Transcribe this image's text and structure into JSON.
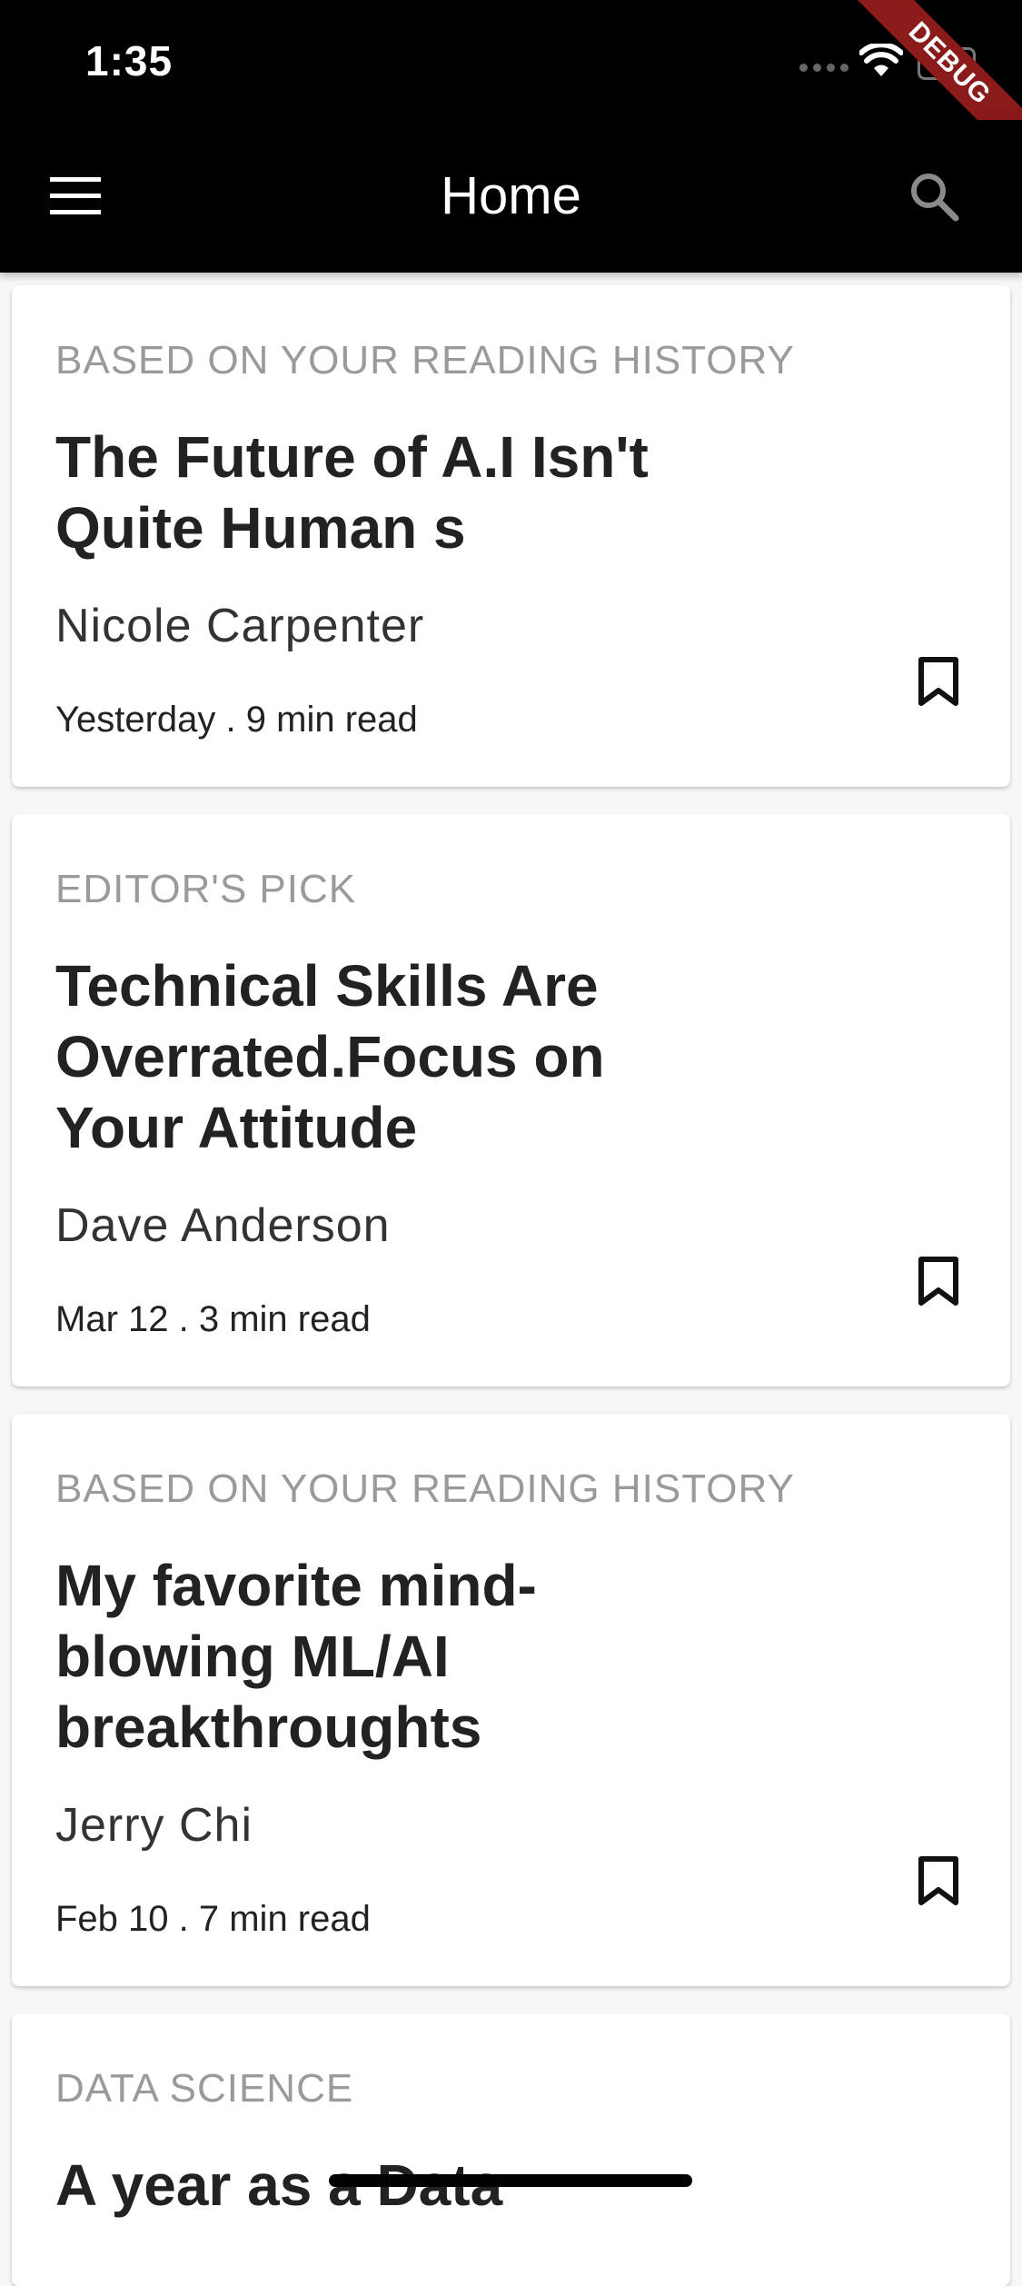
{
  "status_bar": {
    "time": "1:35",
    "debug_label": "DEBUG"
  },
  "app_bar": {
    "title": "Home",
    "menu_icon": "menu-icon",
    "search_icon": "search-icon"
  },
  "articles": [
    {
      "category": "BASED ON YOUR READING HISTORY",
      "title": "The Future of A.I Isn't Quite Human s",
      "author": "Nicole Carpenter",
      "meta": "Yesterday . 9 min read"
    },
    {
      "category": "EDITOR'S PICK",
      "title": "Technical Skills Are Overrated.Focus on Your Attitude",
      "author": "Dave Anderson",
      "meta": "Mar 12 . 3 min read"
    },
    {
      "category": "BASED ON YOUR READING HISTORY",
      "title": "My favorite mind-blowing ML/AI breakthroughts",
      "author": "Jerry Chi",
      "meta": "Feb 10 . 7 min read"
    },
    {
      "category": "DATA SCIENCE",
      "title": "A year as a Data",
      "author": "",
      "meta": ""
    }
  ],
  "colors": {
    "app_bar": "#000000",
    "background": "#f7f7f7",
    "card": "#ffffff",
    "category_text": "#9a9a9a",
    "debug_ribbon": "#8b1a1a"
  }
}
